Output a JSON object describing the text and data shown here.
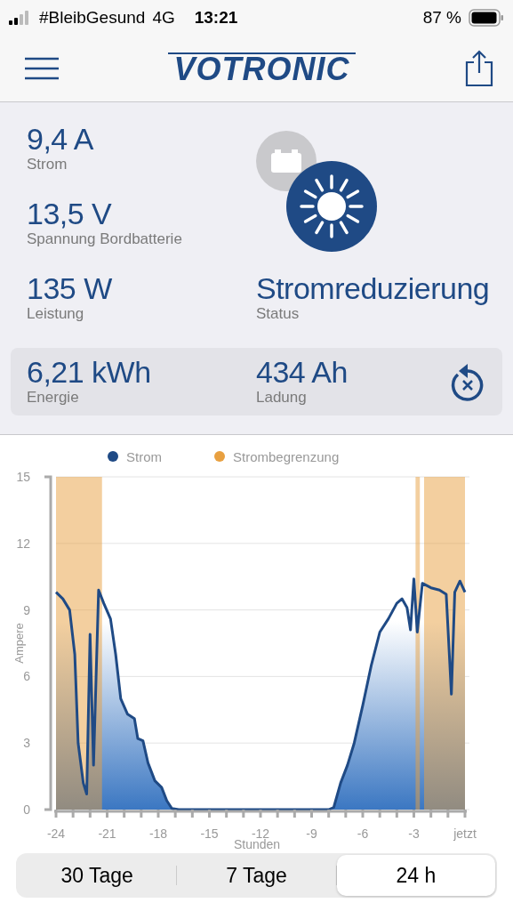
{
  "status_bar": {
    "carrier": "#BleibGesund",
    "network": "4G",
    "time": "13:21",
    "battery": "87 %"
  },
  "header": {
    "logo": "VOTRONIC"
  },
  "metrics": [
    {
      "value": "9,4 A",
      "label": "Strom"
    },
    {
      "value": "13,5 V",
      "label": "Spannung Bordbatterie"
    },
    {
      "value": "135 W",
      "label": "Leistung"
    }
  ],
  "sources": [
    {
      "kind": "battery",
      "selected": false
    },
    {
      "kind": "solar",
      "selected": true
    }
  ],
  "status": {
    "value": "Stromreduzierung",
    "label": "Status"
  },
  "totals": [
    {
      "value": "6,21 kWh",
      "label": "Energie"
    },
    {
      "value": "434 Ah",
      "label": "Ladung"
    }
  ],
  "chart": {
    "chart_data": {
      "type": "area",
      "xlabel": "Stunden",
      "ylabel": "Ampere",
      "x": [
        -24,
        -23.6,
        -23.2,
        -22.9,
        -22.7,
        -22.4,
        -22.2,
        -22.0,
        -21.8,
        -21.5,
        -21.2,
        -20.8,
        -20.5,
        -20.2,
        -19.8,
        -19.4,
        -19.2,
        -18.9,
        -18.6,
        -18.2,
        -17.8,
        -17.5,
        -17.2,
        -16.8,
        -8,
        -7.7,
        -7.3,
        -6.9,
        -6.5,
        -6,
        -5.5,
        -5,
        -4.5,
        -4,
        -3.7,
        -3.4,
        -3.2,
        -3.0,
        -2.8,
        -2.5,
        -2,
        -1.5,
        -1.1,
        -0.8,
        -0.6,
        -0.3,
        0
      ],
      "series": [
        {
          "name": "Strom",
          "color": "#1f4a85",
          "values": [
            9.8,
            9.5,
            9.0,
            7,
            3,
            1.2,
            0.7,
            7.9,
            2,
            9.9,
            9.3,
            8.6,
            7,
            5,
            4.3,
            4.1,
            3.2,
            3.1,
            2.1,
            1.3,
            1.0,
            0.4,
            0.05,
            0,
            0,
            0.1,
            1.2,
            2.0,
            3.0,
            4.7,
            6.5,
            8,
            8.6,
            9.3,
            9.5,
            9.1,
            8.1,
            10.4,
            8,
            10.2,
            10,
            9.9,
            9.7,
            5.2,
            9.8,
            10.3,
            9.8
          ]
        }
      ],
      "bands": [
        {
          "axis": "x",
          "from": -24,
          "to": -21.3,
          "color": "#e8a040"
        },
        {
          "axis": "x",
          "from": -2.9,
          "to": -2.65,
          "color": "#e8a040"
        },
        {
          "axis": "x",
          "from": -2.4,
          "to": 0,
          "color": "#e8a040"
        }
      ],
      "grid": true,
      "xlim": [
        -24,
        0
      ],
      "ylim": [
        0,
        15
      ],
      "xticks": [
        -24,
        -21,
        -18,
        -15,
        -12,
        -9,
        -6,
        -3,
        {
          "value": 0,
          "label": "jetzt"
        }
      ],
      "yticks": [
        0,
        3,
        6,
        9,
        12,
        15
      ]
    },
    "limit_legend": {
      "label": "Strombegrenzung",
      "color": "#e8a040"
    }
  },
  "tabs": [
    {
      "label": "30 Tage",
      "selected": false
    },
    {
      "label": "7 Tage",
      "selected": false
    },
    {
      "label": "24 h",
      "selected": true
    }
  ]
}
